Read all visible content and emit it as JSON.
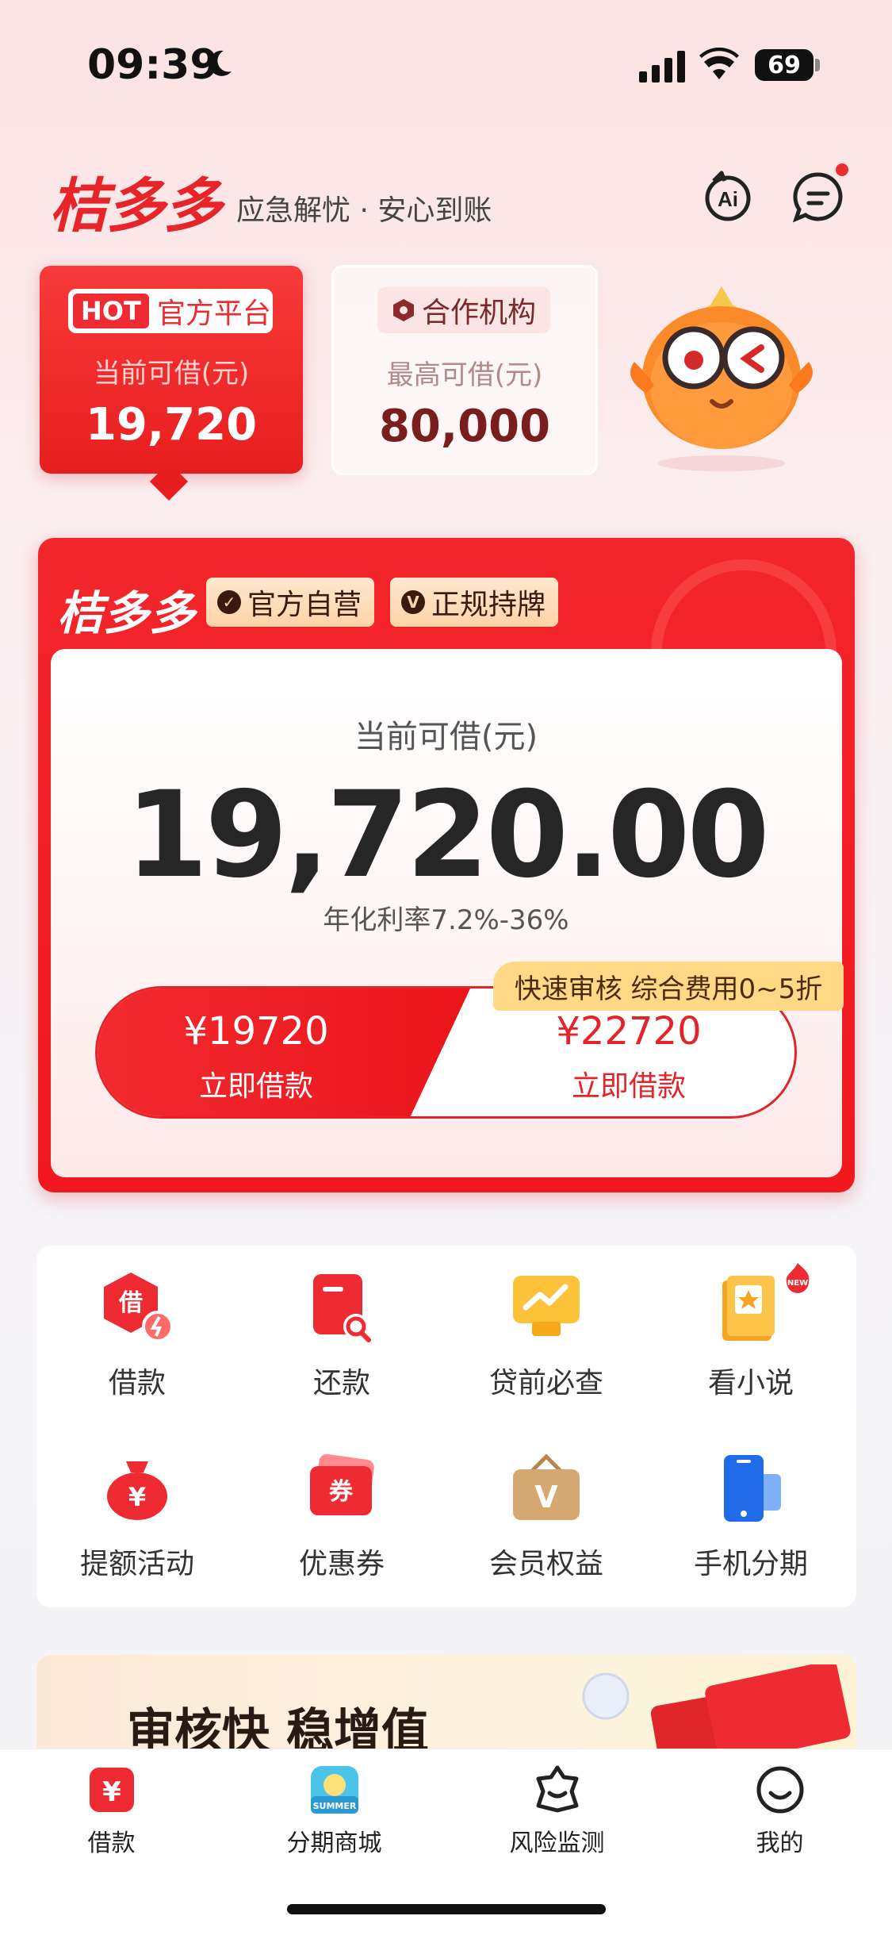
{
  "status_bar": {
    "time": "09:39",
    "battery": "69"
  },
  "header": {
    "logo": "桔多多",
    "slogan": "应急解忧 · 安心到账"
  },
  "tabs_cards": {
    "official": {
      "hot": "HOT",
      "tag": "官方平台",
      "label": "当前可借(元)",
      "value": "19,720"
    },
    "partner": {
      "tag": "合作机构",
      "label": "最高可借(元)",
      "value": "80,000"
    }
  },
  "loan_card": {
    "logo": "桔多多",
    "badges": [
      "官方自营",
      "正规持牌"
    ],
    "available_label": "当前可借(元)",
    "available_value": "19,720.00",
    "rate": "年化利率7.2%-36%",
    "promo_tag": "快速审核 综合费用0~5折",
    "option_left": {
      "amount": "¥19720",
      "action": "立即借款"
    },
    "option_right": {
      "amount": "¥22720",
      "action": "立即借款"
    }
  },
  "grid": [
    {
      "label": "借款",
      "icon": "borrow-icon"
    },
    {
      "label": "还款",
      "icon": "repay-icon"
    },
    {
      "label": "贷前必查",
      "icon": "precheck-icon"
    },
    {
      "label": "看小说",
      "icon": "novel-icon",
      "badge": "NEW"
    },
    {
      "label": "提额活动",
      "icon": "money-bag-icon"
    },
    {
      "label": "优惠券",
      "icon": "coupon-icon"
    },
    {
      "label": "会员权益",
      "icon": "vip-icon",
      "glyph": "V"
    },
    {
      "label": "手机分期",
      "icon": "phone-icon"
    }
  ],
  "banner": {
    "text": "审核快 稳增值"
  },
  "tabbar": [
    {
      "label": "借款",
      "icon": "yen-tab-icon"
    },
    {
      "label": "分期商城",
      "icon": "mall-tab-icon",
      "badge": "SUMMER"
    },
    {
      "label": "风险监测",
      "icon": "risk-tab-icon"
    },
    {
      "label": "我的",
      "icon": "profile-tab-icon"
    }
  ],
  "colors": {
    "brand_red": "#e8242b",
    "gold": "#ffd985"
  }
}
